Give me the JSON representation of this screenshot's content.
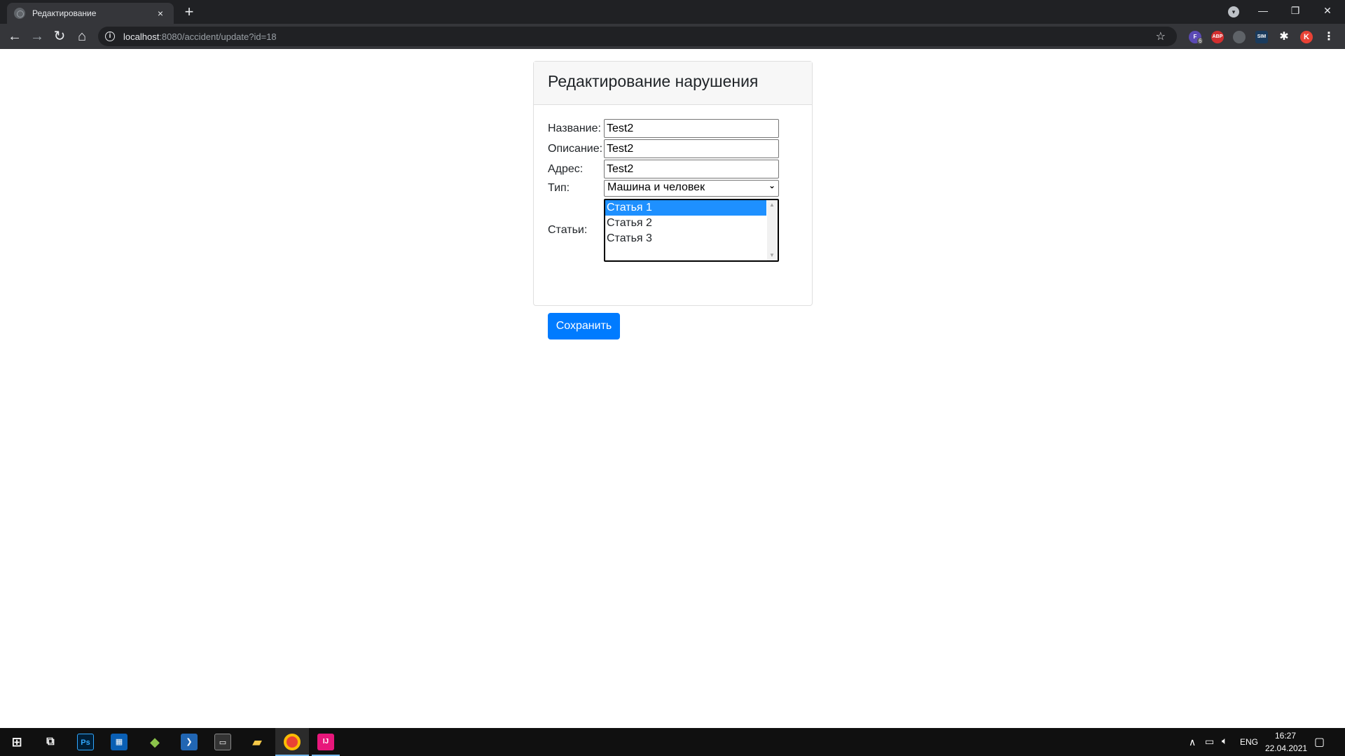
{
  "browser": {
    "tab_title": "Редактирование",
    "tab_close": "×",
    "new_tab": "+",
    "url_host": "localhost",
    "url_path": ":8080/accident/update?id=18"
  },
  "extensions": [
    "F",
    "ABP",
    "",
    "SIM",
    "",
    "K"
  ],
  "extension_badge": "6",
  "form": {
    "title": "Редактирование нарушения",
    "name_label": "Название:",
    "name_value": "Test2",
    "description_label": "Описание:",
    "description_value": "Test2",
    "address_label": "Адрес:",
    "address_value": "Test2",
    "type_label": "Тип:",
    "type_value": "Машина и человек",
    "articles_label": "Статьи:",
    "articles": [
      "Статья 1",
      "Статья 2",
      "Статья 3"
    ],
    "selected_article": "Статья 1",
    "save_label": "Сохранить"
  },
  "taskbar": {
    "apps": [
      "windows-start",
      "task-view",
      "photoshop",
      "arduino",
      "gitkraken",
      "powershell",
      "terminal",
      "file-explorer",
      "chrome",
      "intellij"
    ],
    "lang": "ENG",
    "time": "16:27",
    "date": "22.04.2021"
  },
  "colors": {
    "accent": "#007bff",
    "selected_option": "#1e90ff",
    "chrome_dark": "#202124",
    "chrome_toolbar": "#35363a"
  }
}
